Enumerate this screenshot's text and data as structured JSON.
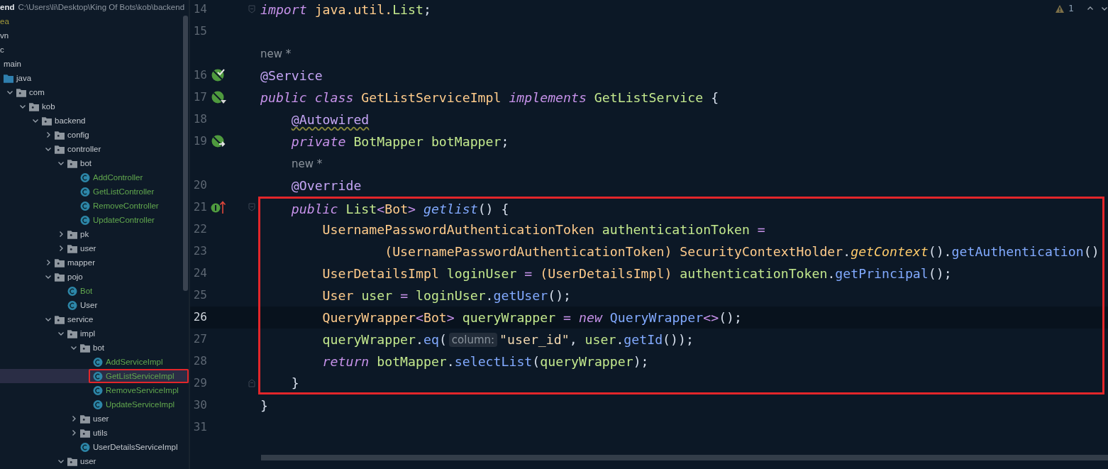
{
  "project": {
    "name": "end",
    "path": "C:\\Users\\li\\Desktop\\King Of Bots\\kob\\backend"
  },
  "tree": [
    {
      "label": "ea",
      "color": "#a59b3a",
      "selected": false,
      "marked": false
    },
    {
      "label": "vn",
      "selected": false,
      "marked": false
    },
    {
      "label": "c",
      "selected": false,
      "marked": false,
      "children": [
        {
          "label": "main",
          "selected": false,
          "marked": false,
          "children": [
            {
              "label": "java",
              "kind": "source-root",
              "selected": false,
              "marked": false,
              "children": [
                {
                  "label": "com",
                  "kind": "package",
                  "expanded": true,
                  "selected": false,
                  "marked": false,
                  "children": [
                    {
                      "label": "kob",
                      "kind": "package",
                      "expanded": true,
                      "selected": false,
                      "marked": false,
                      "children": [
                        {
                          "label": "backend",
                          "kind": "package",
                          "expanded": true,
                          "selected": false,
                          "marked": false,
                          "children": [
                            {
                              "label": "config",
                              "kind": "package",
                              "expanded": false,
                              "selected": false,
                              "marked": false
                            },
                            {
                              "label": "controller",
                              "kind": "package",
                              "expanded": true,
                              "selected": false,
                              "marked": false,
                              "children": [
                                {
                                  "label": "bot",
                                  "kind": "package",
                                  "expanded": true,
                                  "selected": false,
                                  "marked": false,
                                  "children": [
                                    {
                                      "label": "AddController",
                                      "kind": "class",
                                      "color": "#62a84e",
                                      "selected": false,
                                      "marked": false
                                    },
                                    {
                                      "label": "GetListController",
                                      "kind": "class",
                                      "color": "#62a84e",
                                      "selected": false,
                                      "marked": false
                                    },
                                    {
                                      "label": "RemoveController",
                                      "kind": "class",
                                      "color": "#62a84e",
                                      "selected": false,
                                      "marked": false
                                    },
                                    {
                                      "label": "UpdateController",
                                      "kind": "class",
                                      "color": "#62a84e",
                                      "selected": false,
                                      "marked": false
                                    }
                                  ]
                                },
                                {
                                  "label": "pk",
                                  "kind": "package",
                                  "expanded": false,
                                  "selected": false,
                                  "marked": false
                                },
                                {
                                  "label": "user",
                                  "kind": "package",
                                  "expanded": false,
                                  "selected": false,
                                  "marked": false
                                }
                              ]
                            },
                            {
                              "label": "mapper",
                              "kind": "package",
                              "expanded": false,
                              "selected": false,
                              "marked": false
                            },
                            {
                              "label": "pojo",
                              "kind": "package",
                              "expanded": true,
                              "selected": false,
                              "marked": false,
                              "children": [
                                {
                                  "label": "Bot",
                                  "kind": "class",
                                  "color": "#62a84e",
                                  "selected": false,
                                  "marked": false
                                },
                                {
                                  "label": "User",
                                  "kind": "class",
                                  "selected": false,
                                  "marked": false
                                }
                              ]
                            },
                            {
                              "label": "service",
                              "kind": "package",
                              "expanded": true,
                              "selected": false,
                              "marked": false,
                              "children": [
                                {
                                  "label": "impl",
                                  "kind": "package",
                                  "expanded": true,
                                  "selected": false,
                                  "marked": false,
                                  "children": [
                                    {
                                      "label": "bot",
                                      "kind": "package",
                                      "expanded": true,
                                      "selected": false,
                                      "marked": false,
                                      "children": [
                                        {
                                          "label": "AddServiceImpl",
                                          "kind": "class",
                                          "color": "#62a84e",
                                          "selected": false,
                                          "marked": false
                                        },
                                        {
                                          "label": "GetListServiceImpl",
                                          "kind": "class",
                                          "color": "#62a84e",
                                          "selected": true,
                                          "marked": true
                                        },
                                        {
                                          "label": "RemoveServiceImpl",
                                          "kind": "class",
                                          "color": "#62a84e",
                                          "selected": false,
                                          "marked": false
                                        },
                                        {
                                          "label": "UpdateServiceImpl",
                                          "kind": "class",
                                          "color": "#62a84e",
                                          "selected": false,
                                          "marked": false
                                        }
                                      ]
                                    },
                                    {
                                      "label": "user",
                                      "kind": "package",
                                      "expanded": false,
                                      "selected": false,
                                      "marked": false
                                    },
                                    {
                                      "label": "utils",
                                      "kind": "package",
                                      "expanded": false,
                                      "selected": false,
                                      "marked": false
                                    },
                                    {
                                      "label": "UserDetailsServiceImpl",
                                      "kind": "class",
                                      "selected": false,
                                      "marked": false
                                    }
                                  ]
                                },
                                {
                                  "label": "user",
                                  "kind": "package",
                                  "expanded": true,
                                  "selected": false,
                                  "marked": false
                                }
                              ]
                            }
                          ]
                        }
                      ]
                    }
                  ]
                }
              ]
            }
          ]
        }
      ]
    }
  ],
  "inspections": {
    "warnings": "1"
  },
  "lines": [
    {
      "kind": "code",
      "number": "14",
      "fold": {
        "kind": "start"
      },
      "current": false,
      "marked": false,
      "tokens": [
        {
          "text": "import",
          "kind": "kw"
        },
        {
          "text": " java.util.",
          "kind": "type"
        },
        {
          "text": "List",
          "kind": "name"
        },
        {
          "text": ";",
          "kind": "punct"
        }
      ]
    },
    {
      "kind": "code",
      "number": "15",
      "current": false,
      "marked": false
    },
    {
      "kind": "hint",
      "text": "new *",
      "marked": false
    },
    {
      "kind": "code",
      "number": "16",
      "marker": {
        "kind": "bean-check"
      },
      "current": false,
      "marked": false,
      "tokens": [
        {
          "text": "@Service",
          "kind": "ann"
        }
      ]
    },
    {
      "kind": "code",
      "number": "17",
      "marker": {
        "kind": "bean-down"
      },
      "current": false,
      "marked": false,
      "tokens": [
        {
          "text": "public class",
          "kind": "kw"
        },
        {
          "text": " GetListServiceImpl ",
          "kind": "type"
        },
        {
          "text": "implements",
          "kind": "kw"
        },
        {
          "text": " GetListService",
          "kind": "name"
        },
        {
          "text": " {",
          "kind": "punct"
        }
      ]
    },
    {
      "kind": "code",
      "number": "18",
      "current": false,
      "marked": false,
      "tokens": [
        {
          "text": "    @Autowired",
          "kind": "annwarn"
        }
      ]
    },
    {
      "kind": "code",
      "number": "19",
      "marker": {
        "kind": "bean-arrow"
      },
      "current": false,
      "marked": false,
      "tokens": [
        {
          "text": "    private",
          "kind": "kw"
        },
        {
          "text": " BotMapper botMapper",
          "kind": "name"
        },
        {
          "text": ";",
          "kind": "punct"
        }
      ]
    },
    {
      "kind": "hint",
      "text": "new *",
      "marked": false
    },
    {
      "kind": "code",
      "number": "20",
      "current": false,
      "marked": false,
      "tokens": [
        {
          "text": "    @Override",
          "kind": "ann"
        }
      ]
    },
    {
      "kind": "code",
      "number": "21",
      "marker": {
        "kind": "implements-up"
      },
      "fold": {
        "kind": "start"
      },
      "current": false,
      "marked": true,
      "tokens": [
        {
          "text": "    public",
          "kind": "kw"
        },
        {
          "text": " List",
          "kind": "name"
        },
        {
          "text": "<",
          "kind": "op"
        },
        {
          "text": "Bot",
          "kind": "type"
        },
        {
          "text": ">",
          "kind": "op"
        },
        {
          "text": " getlist",
          "kind": "fn"
        },
        {
          "text": "() {",
          "kind": "punct"
        }
      ]
    },
    {
      "kind": "code",
      "number": "22",
      "current": false,
      "marked": true,
      "tokens": [
        {
          "text": "        UsernamePasswordAuthenticationToken",
          "kind": "type"
        },
        {
          "text": " authenticationToken",
          "kind": "name"
        },
        {
          "text": " =",
          "kind": "op"
        }
      ]
    },
    {
      "kind": "code",
      "number": "23",
      "current": false,
      "marked": true,
      "tokens": [
        {
          "text": "                (UsernamePasswordAuthenticationToken) SecurityContextHolder",
          "kind": "type"
        },
        {
          "text": ".",
          "kind": "punct"
        },
        {
          "text": "getContext",
          "kind": "static"
        },
        {
          "text": "().",
          "kind": "punct"
        },
        {
          "text": "getAuthentication",
          "kind": "method"
        },
        {
          "text": "()",
          "kind": "punct"
        }
      ]
    },
    {
      "kind": "code",
      "number": "24",
      "current": false,
      "marked": true,
      "tokens": [
        {
          "text": "        UserDetailsImpl",
          "kind": "type"
        },
        {
          "text": " loginUser",
          "kind": "name"
        },
        {
          "text": " =",
          "kind": "op"
        },
        {
          "text": " (UserDetailsImpl)",
          "kind": "type"
        },
        {
          "text": " authenticationToken",
          "kind": "name"
        },
        {
          "text": ".",
          "kind": "punct"
        },
        {
          "text": "getPrincipal",
          "kind": "method"
        },
        {
          "text": "();",
          "kind": "punct"
        }
      ]
    },
    {
      "kind": "code",
      "number": "25",
      "current": false,
      "marked": true,
      "tokens": [
        {
          "text": "        User",
          "kind": "type"
        },
        {
          "text": " user",
          "kind": "name"
        },
        {
          "text": " =",
          "kind": "op"
        },
        {
          "text": " loginUser",
          "kind": "name"
        },
        {
          "text": ".",
          "kind": "punct"
        },
        {
          "text": "getUser",
          "kind": "method"
        },
        {
          "text": "();",
          "kind": "punct"
        }
      ]
    },
    {
      "kind": "code",
      "number": "26",
      "current": true,
      "marked": true,
      "tokens": [
        {
          "text": "        QueryWrapper",
          "kind": "type"
        },
        {
          "text": "<",
          "kind": "op"
        },
        {
          "text": "Bot",
          "kind": "type"
        },
        {
          "text": ">",
          "kind": "op"
        },
        {
          "text": " queryWrapper",
          "kind": "name"
        },
        {
          "text": " =",
          "kind": "op"
        },
        {
          "text": " new",
          "kind": "kw"
        },
        {
          "text": " QueryWrapper",
          "kind": "method"
        },
        {
          "text": "<>",
          "kind": "op"
        },
        {
          "text": "();",
          "kind": "punct"
        }
      ]
    },
    {
      "kind": "code",
      "number": "27",
      "current": false,
      "marked": true,
      "tokens": [
        {
          "text": "        queryWrapper",
          "kind": "name"
        },
        {
          "text": ".",
          "kind": "punct"
        },
        {
          "text": "eq",
          "kind": "method"
        },
        {
          "text": "(",
          "kind": "punct"
        },
        {
          "text": "column:",
          "kind": "inlay"
        },
        {
          "text": "\"user_id\"",
          "kind": "str"
        },
        {
          "text": ", ",
          "kind": "punct"
        },
        {
          "text": "user",
          "kind": "name"
        },
        {
          "text": ".",
          "kind": "punct"
        },
        {
          "text": "getId",
          "kind": "method"
        },
        {
          "text": "());",
          "kind": "punct"
        }
      ]
    },
    {
      "kind": "code",
      "number": "28",
      "current": false,
      "marked": true,
      "tokens": [
        {
          "text": "        return",
          "kind": "kw"
        },
        {
          "text": " botMapper",
          "kind": "name"
        },
        {
          "text": ".",
          "kind": "punct"
        },
        {
          "text": "selectList",
          "kind": "method"
        },
        {
          "text": "(",
          "kind": "punct"
        },
        {
          "text": "queryWrapper",
          "kind": "name"
        },
        {
          "text": ");",
          "kind": "punct"
        }
      ]
    },
    {
      "kind": "code",
      "number": "29",
      "fold": {
        "kind": "end"
      },
      "current": false,
      "marked": true,
      "tokens": [
        {
          "text": "    }",
          "kind": "punct"
        }
      ]
    },
    {
      "kind": "code",
      "number": "30",
      "current": false,
      "marked": false,
      "tokens": [
        {
          "text": "}",
          "kind": "punct"
        }
      ]
    },
    {
      "kind": "code",
      "number": "31",
      "current": false,
      "marked": false
    }
  ]
}
